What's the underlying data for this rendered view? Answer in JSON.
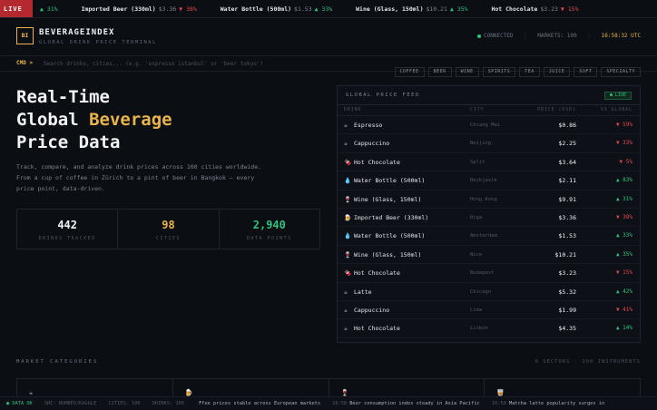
{
  "ticker": {
    "live_label": "LIVE",
    "items": [
      {
        "name": "",
        "price": "",
        "change": "▲ 31%",
        "dir": "up"
      },
      {
        "name": "Imported Beer (330ml)",
        "price": "$3.36",
        "change": "▼ 38%",
        "dir": "down"
      },
      {
        "name": "Water Bottle (500ml)",
        "price": "$1.53",
        "change": "▲ 33%",
        "dir": "up"
      },
      {
        "name": "Wine (Glass, 150ml)",
        "price": "$10.21",
        "change": "▲ 35%",
        "dir": "up"
      },
      {
        "name": "Hot Chocolate",
        "price": "$3.23",
        "change": "▼ 15%",
        "dir": "down"
      }
    ]
  },
  "header": {
    "logo": "BI",
    "brand": "BEVERAGEINDEX",
    "subtitle": "GLOBAL DRINK PRICE TERMINAL",
    "status": "CONNECTED",
    "markets": "MARKETS: 100",
    "clock": "16:58:32 UTC"
  },
  "command": {
    "label": "CMD >",
    "placeholder": "Search drinks, cities... (e.g. 'espresso istanbul' or 'beer tokyo')",
    "chips": [
      "COFFEE",
      "BEER",
      "WINE",
      "SPIRITS",
      "TEA",
      "JUICE",
      "SOFT",
      "SPECIALTY"
    ]
  },
  "hero": {
    "line1": "Real-Time",
    "line2a": "Global ",
    "line2b": "Beverage",
    "line3": "Price Data",
    "description": "Track, compare, and analyze drink prices across 100 cities worldwide. From a cup of coffee in Zürich to a pint of beer in Bangkok — every price point, data-driven."
  },
  "stats": [
    {
      "value": "442",
      "label": "DRINKS TRACKED",
      "color": "#f3f4f6"
    },
    {
      "value": "98",
      "label": "CITIES",
      "color": "#e9b44c"
    },
    {
      "value": "2,940",
      "label": "DATA POINTS",
      "color": "#2ec27e"
    }
  ],
  "feed": {
    "title": "GLOBAL PRICE FEED",
    "badge": "● LIVE",
    "columns": {
      "drink": "DRINK",
      "city": "CITY",
      "price": "PRICE (USD)",
      "vs": "VS GLOBAL"
    },
    "rows": [
      {
        "icon": "☕",
        "drink": "Espresso",
        "city": "Chiang Mai",
        "price": "$0.86",
        "vs": "▼ 59%",
        "dir": "down"
      },
      {
        "icon": "☕",
        "drink": "Cappuccino",
        "city": "Beijing",
        "price": "$2.25",
        "vs": "▼ 33%",
        "dir": "down"
      },
      {
        "icon": "🍫",
        "drink": "Hot Chocolate",
        "city": "Split",
        "price": "$3.64",
        "vs": "▼ 5%",
        "dir": "down"
      },
      {
        "icon": "💧",
        "drink": "Water Bottle (500ml)",
        "city": "Reykjavik",
        "price": "$2.11",
        "vs": "▲ 83%",
        "dir": "up"
      },
      {
        "icon": "🍷",
        "drink": "Wine (Glass, 150ml)",
        "city": "Hong Kong",
        "price": "$9.91",
        "vs": "▲ 31%",
        "dir": "up"
      },
      {
        "icon": "🍺",
        "drink": "Imported Beer (330ml)",
        "city": "Riga",
        "price": "$3.36",
        "vs": "▼ 38%",
        "dir": "down"
      },
      {
        "icon": "💧",
        "drink": "Water Bottle (500ml)",
        "city": "Amsterdam",
        "price": "$1.53",
        "vs": "▲ 33%",
        "dir": "up"
      },
      {
        "icon": "🍷",
        "drink": "Wine (Glass, 150ml)",
        "city": "Nice",
        "price": "$10.21",
        "vs": "▲ 35%",
        "dir": "up"
      },
      {
        "icon": "🍫",
        "drink": "Hot Chocolate",
        "city": "Budapest",
        "price": "$3.23",
        "vs": "▼ 15%",
        "dir": "down"
      },
      {
        "icon": "☕",
        "drink": "Latte",
        "city": "Chicago",
        "price": "$5.32",
        "vs": "▲ 42%",
        "dir": "up"
      },
      {
        "icon": "☕",
        "drink": "Cappuccino",
        "city": "Lima",
        "price": "$1.99",
        "vs": "▼ 41%",
        "dir": "down"
      },
      {
        "icon": "☕",
        "drink": "Hot Chocolate",
        "city": "Lisbon",
        "price": "$4.35",
        "vs": "▲ 14%",
        "dir": "up"
      }
    ]
  },
  "categories": {
    "title": "MARKET CATEGORIES",
    "meta": "8 SECTORS · 300 INSTRUMENTS",
    "icons": [
      "☕",
      "🍺",
      "🍷",
      "🥃"
    ]
  },
  "statusbar": {
    "ok": "● DATA OK",
    "src": "SRC: NUMBEO/KAGGLE",
    "cities": "CITIES: 100",
    "drinks": "DRINKS: 100",
    "news": [
      {
        "time": "",
        "text": "Ffee prices stable across European markets"
      },
      {
        "time": "16:58",
        "text": "Beer consumption index steady in Asia Pacific"
      },
      {
        "time": "16:58",
        "text": "Matcha latte popularity surges in"
      }
    ]
  },
  "colors": {
    "accent": "#e9b44c",
    "up": "#2ec27e",
    "down": "#e5484d",
    "live": "#b3292f"
  }
}
